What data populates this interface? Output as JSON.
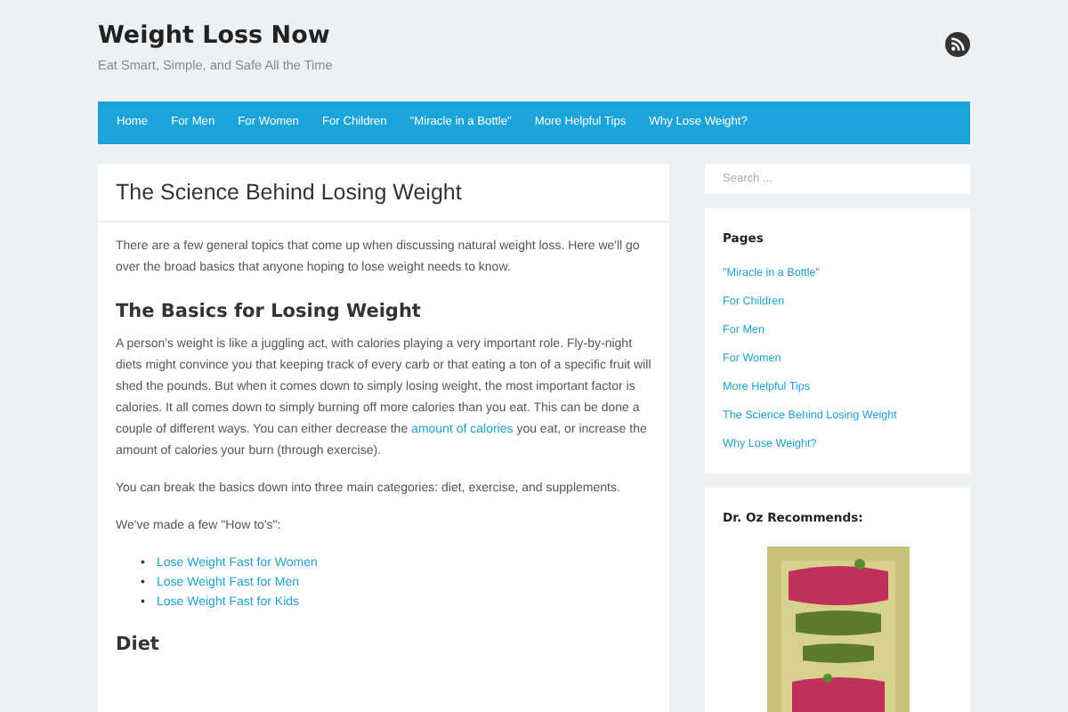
{
  "site": {
    "title": "Weight Loss Now",
    "tagline": "Eat Smart, Simple, and Safe All the Time"
  },
  "nav": [
    "Home",
    "For Men",
    "For Women",
    "For Children",
    "\"Miracle in a Bottle\"",
    "More Helpful Tips",
    "Why Lose Weight?"
  ],
  "article": {
    "title": "The Science Behind Losing Weight",
    "blocks": [
      {
        "kind": "paragraph",
        "parts": [
          {
            "kind": "text",
            "text": "There are a few general topics that come up when discussing natural weight loss. Here we'll go over the broad basics that anyone hoping to lose weight needs to know."
          }
        ]
      },
      {
        "kind": "heading",
        "text": "The Basics for Losing Weight"
      },
      {
        "kind": "paragraph",
        "parts": [
          {
            "kind": "text",
            "text": "A person's weight is like a juggling act, with calories playing a very important role. Fly-by-night diets might convince you that keeping track of every carb or that eating a ton of a specific fruit will shed the pounds. But when it comes down to simply losing weight, the most important factor is calories. It all comes down to simply burning off more calories than you eat. This can be done a couple of different ways. You can either decrease the "
          },
          {
            "kind": "link",
            "text": "amount of calories"
          },
          {
            "kind": "text",
            "text": " you eat, or increase the amount of calories your burn (through exercise)."
          }
        ]
      },
      {
        "kind": "paragraph",
        "parts": [
          {
            "kind": "text",
            "text": "You can break the basics down into three main categories: diet, exercise, and supplements."
          }
        ]
      },
      {
        "kind": "paragraph",
        "parts": [
          {
            "kind": "text",
            "text": "We've made a few \"How to's\":"
          }
        ]
      },
      {
        "kind": "list",
        "items": [
          {
            "marker": "•",
            "text": "Lose Weight Fast for Women"
          },
          {
            "marker": "•",
            "text": "Lose Weight Fast for Men"
          },
          {
            "marker": "•",
            "text": "Lose Weight Fast for Kids"
          }
        ]
      },
      {
        "kind": "heading",
        "text": "Diet"
      }
    ]
  },
  "sidebar": {
    "search": {
      "placeholder": "Search ..."
    },
    "widgets": [
      {
        "kind": "links",
        "title": "Pages",
        "items": [
          "\"Miracle in a Bottle\"",
          "For Children",
          "For Men",
          "For Women",
          "More Helpful Tips",
          "The Science Behind Losing Weight",
          "Why Lose Weight?"
        ]
      },
      {
        "kind": "picture",
        "title": "Dr. Oz Recommends:"
      }
    ]
  }
}
